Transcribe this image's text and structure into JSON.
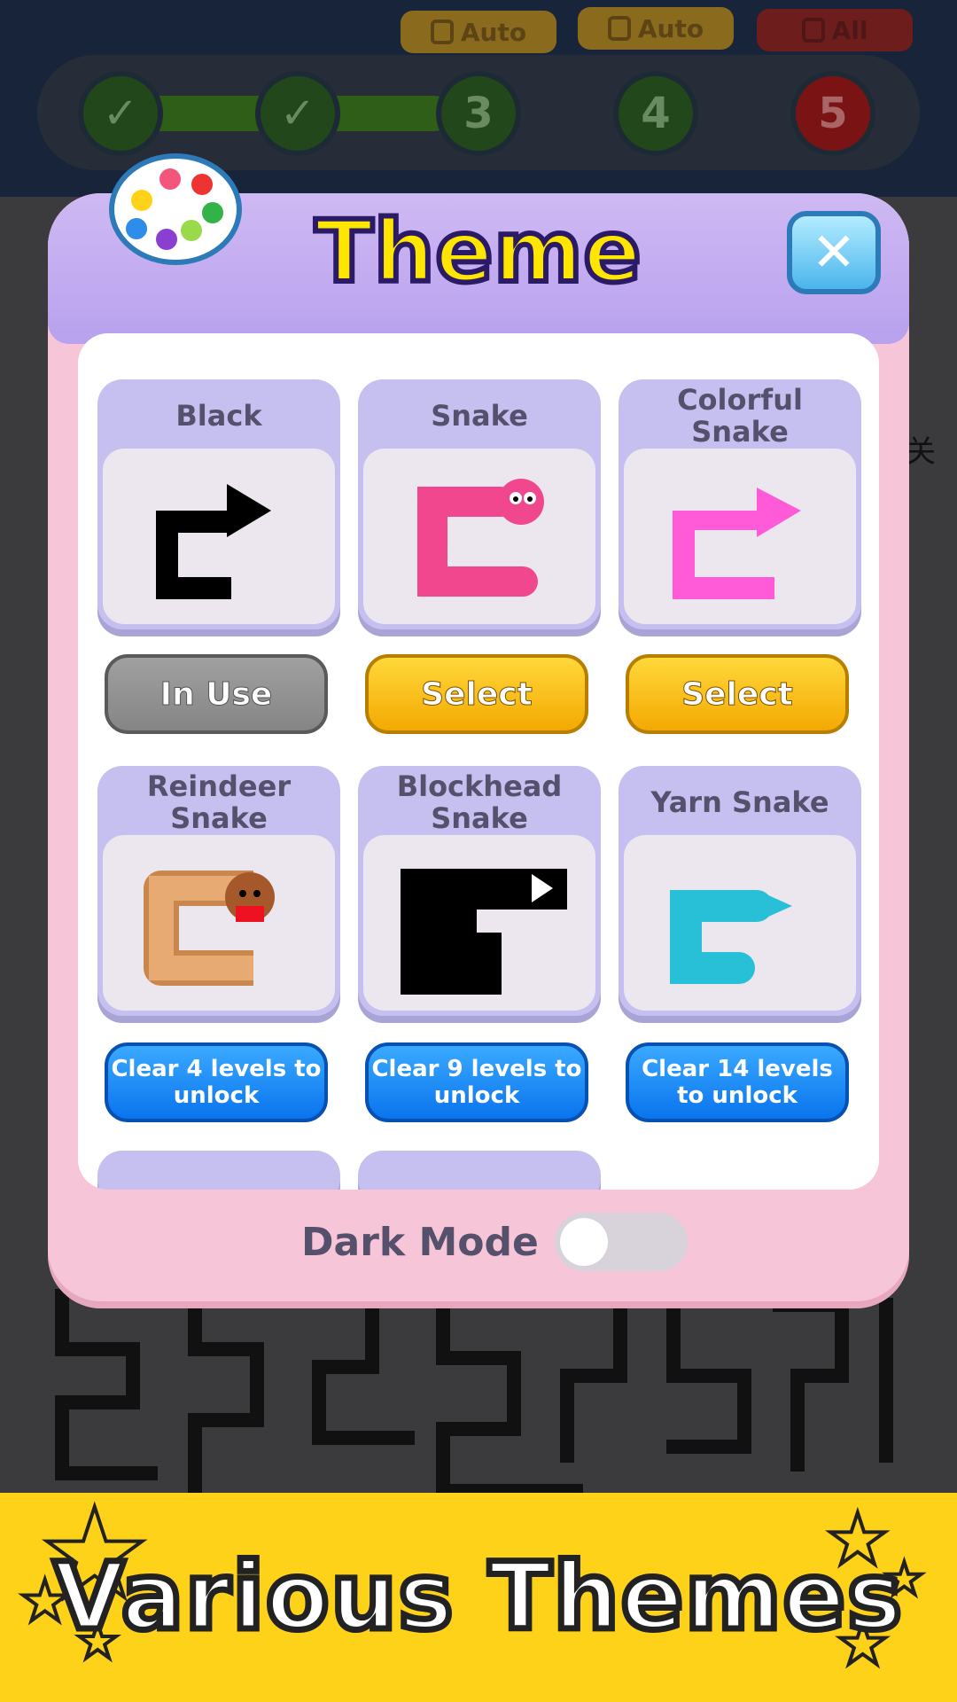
{
  "progress": {
    "tags": [
      "Auto",
      "Auto",
      "All"
    ],
    "nodes": [
      {
        "label": "✓",
        "state": "done"
      },
      {
        "label": "✓",
        "state": "done"
      },
      {
        "label": "3",
        "state": "pending"
      },
      {
        "label": "4",
        "state": "pending"
      },
      {
        "label": "5",
        "state": "boss"
      }
    ]
  },
  "dialog": {
    "title": "Theme",
    "close_icon": "close-icon",
    "palette_icon": "paint-palette-icon"
  },
  "themes": [
    {
      "name": "Black",
      "button": "In Use",
      "state": "in-use"
    },
    {
      "name": "Snake",
      "button": "Select",
      "state": "select"
    },
    {
      "name": "Colorful\nSnake",
      "button": "Select",
      "state": "select"
    },
    {
      "name": "Reindeer\nSnake",
      "button": "Clear 4 levels to unlock",
      "state": "locked"
    },
    {
      "name": "Blockhead\nSnake",
      "button": "Clear 9 levels to unlock",
      "state": "locked"
    },
    {
      "name": "Yarn Snake",
      "button": "Clear 14 levels to unlock",
      "state": "locked"
    }
  ],
  "dark_mode": {
    "label": "Dark Mode",
    "enabled": false
  },
  "banner": {
    "text": "Various Themes"
  },
  "side_glyph": "关"
}
